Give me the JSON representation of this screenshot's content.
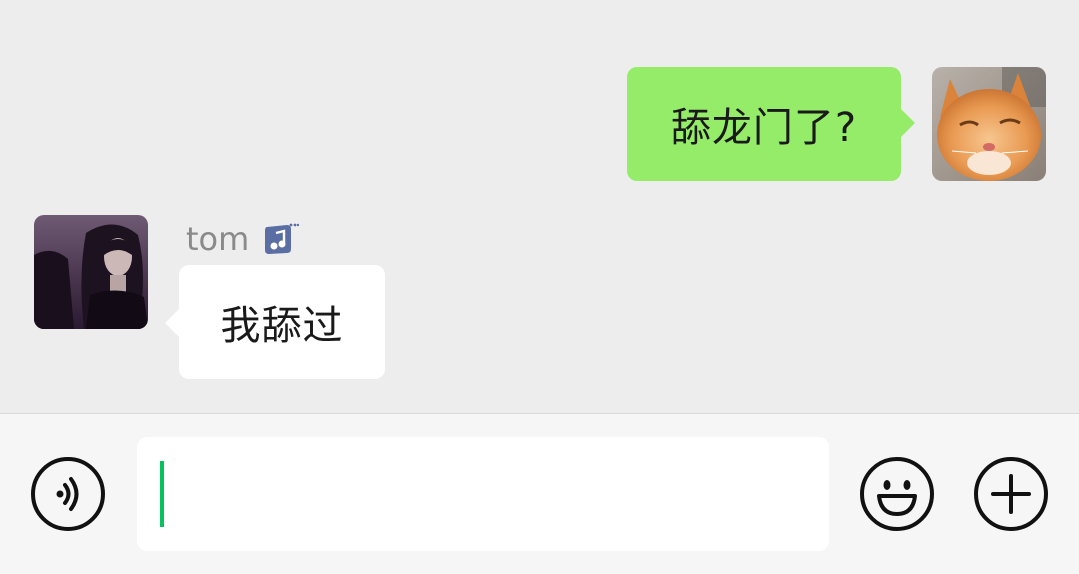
{
  "messages": [
    {
      "sender": "self",
      "text": "舔龙门了?",
      "avatar_icon": "cat-avatar"
    },
    {
      "sender": "tom",
      "sender_name": "tom",
      "text": "我舔过",
      "avatar_icon": "person-avatar",
      "status_icon": "music-status-icon"
    }
  ],
  "input_bar": {
    "voice_icon": "voice-icon",
    "emoji_icon": "emoji-icon",
    "plus_icon": "plus-icon",
    "text_value": ""
  },
  "colors": {
    "chat_background": "#ededed",
    "self_bubble": "#95ec69",
    "other_bubble": "#ffffff",
    "caret": "#07c160"
  }
}
